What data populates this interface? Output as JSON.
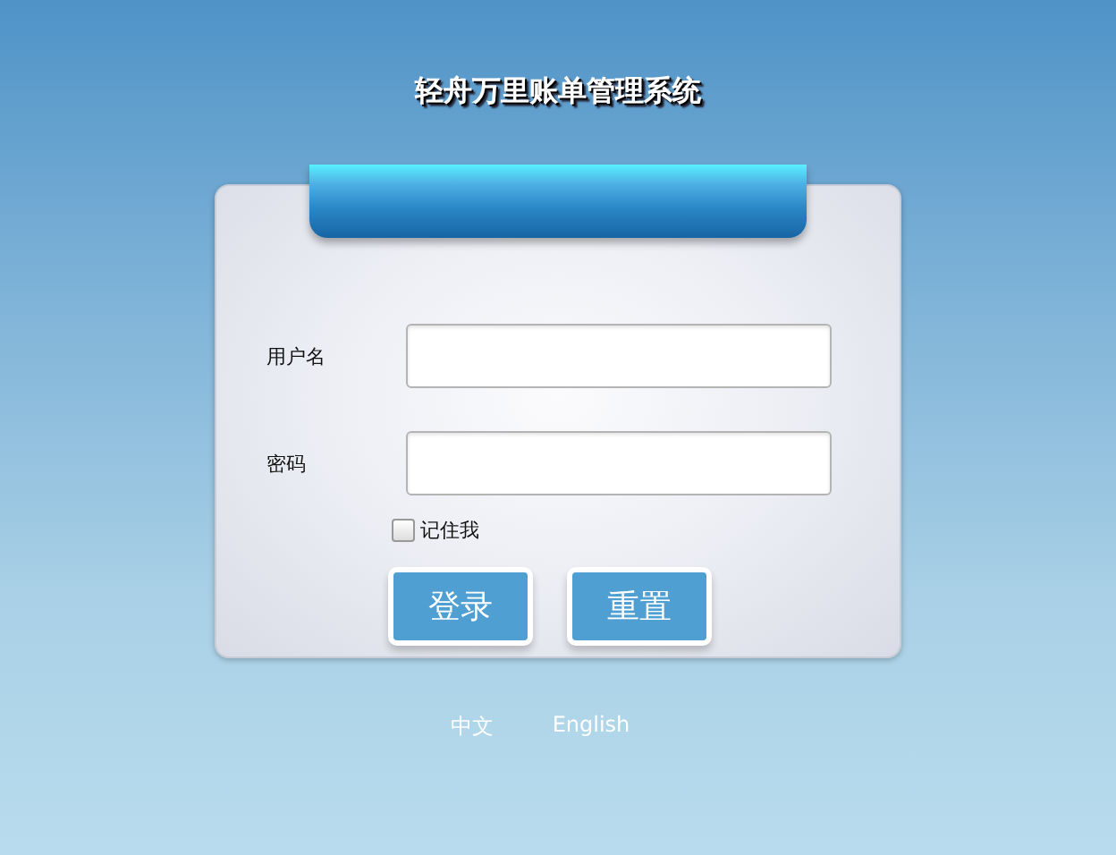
{
  "title": "轻舟万里账单管理系统",
  "form": {
    "fields": [
      {
        "label": "用户名"
      },
      {
        "label": "密码"
      }
    ],
    "remember": {
      "label": "记住我",
      "checked": false
    },
    "buttons": [
      "登录",
      "重置"
    ]
  },
  "languages": [
    {
      "label": "中文"
    },
    {
      "label": "English"
    }
  ]
}
